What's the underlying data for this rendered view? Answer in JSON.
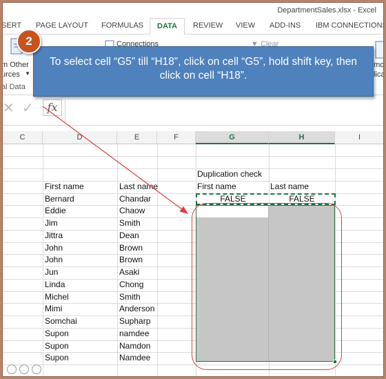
{
  "window": {
    "title": "DepartmentSales.xlsx - Excel"
  },
  "tabs": [
    {
      "label": "SERT",
      "active": false
    },
    {
      "label": "PAGE LAYOUT",
      "active": false
    },
    {
      "label": "FORMULAS",
      "active": false
    },
    {
      "label": "DATA",
      "active": true
    },
    {
      "label": "REVIEW",
      "active": false
    },
    {
      "label": "VIEW",
      "active": false
    },
    {
      "label": "ADD-INS",
      "active": false
    },
    {
      "label": "IBM CONNECTIONS",
      "active": false
    }
  ],
  "ribbon": {
    "from_other_line1": "m Other",
    "from_other_line2": "urces",
    "group_label": "al Data",
    "connections_label": "Connections",
    "clear_label": "Clear",
    "remove_line1": "emo",
    "remove_line2": "plica"
  },
  "formula_bar": {
    "cancel": "✕",
    "enter": "✓",
    "fx": "fx",
    "value": ""
  },
  "columns": [
    {
      "label": "C",
      "selected": false
    },
    {
      "label": "D",
      "selected": false
    },
    {
      "label": "E",
      "selected": false
    },
    {
      "label": "F",
      "selected": false
    },
    {
      "label": "G",
      "selected": true
    },
    {
      "label": "H",
      "selected": true
    },
    {
      "label": "I",
      "selected": false
    }
  ],
  "sheet": {
    "duplication_header": "Duplication check",
    "headers": {
      "d": "First name",
      "e": "Last name",
      "g": "First name",
      "h": "Last name"
    },
    "flags": {
      "g": "FALSE",
      "h": "FALSE"
    },
    "rows": [
      {
        "first": "Bernard",
        "last": "Chandar"
      },
      {
        "first": "Eddie",
        "last": "Chaow"
      },
      {
        "first": "Jim",
        "last": "Smith"
      },
      {
        "first": "Jittra",
        "last": "Dean"
      },
      {
        "first": "John",
        "last": "Brown"
      },
      {
        "first": "John",
        "last": "Brown"
      },
      {
        "first": "Jun",
        "last": "Asaki"
      },
      {
        "first": "Linda",
        "last": "Chong"
      },
      {
        "first": "Michel",
        "last": "Smith"
      },
      {
        "first": "Mimi",
        "last": "Anderson"
      },
      {
        "first": "Somchai",
        "last": "Supharp"
      },
      {
        "first": "Supon",
        "last": "namdee"
      },
      {
        "first": "Supon",
        "last": "Namdon"
      },
      {
        "first": "Supon",
        "last": "Namdee"
      }
    ]
  },
  "callout": {
    "step_number": "2",
    "text": "To select cell “G5” till “H18”, click on cell “G5”, hold shift key, then click on cell “H18”."
  },
  "colors": {
    "accent": "#217346",
    "callout": "#4f81bd",
    "badge": "#c9531f",
    "highlight": "#e03c3c",
    "frame": "#b7856a"
  }
}
